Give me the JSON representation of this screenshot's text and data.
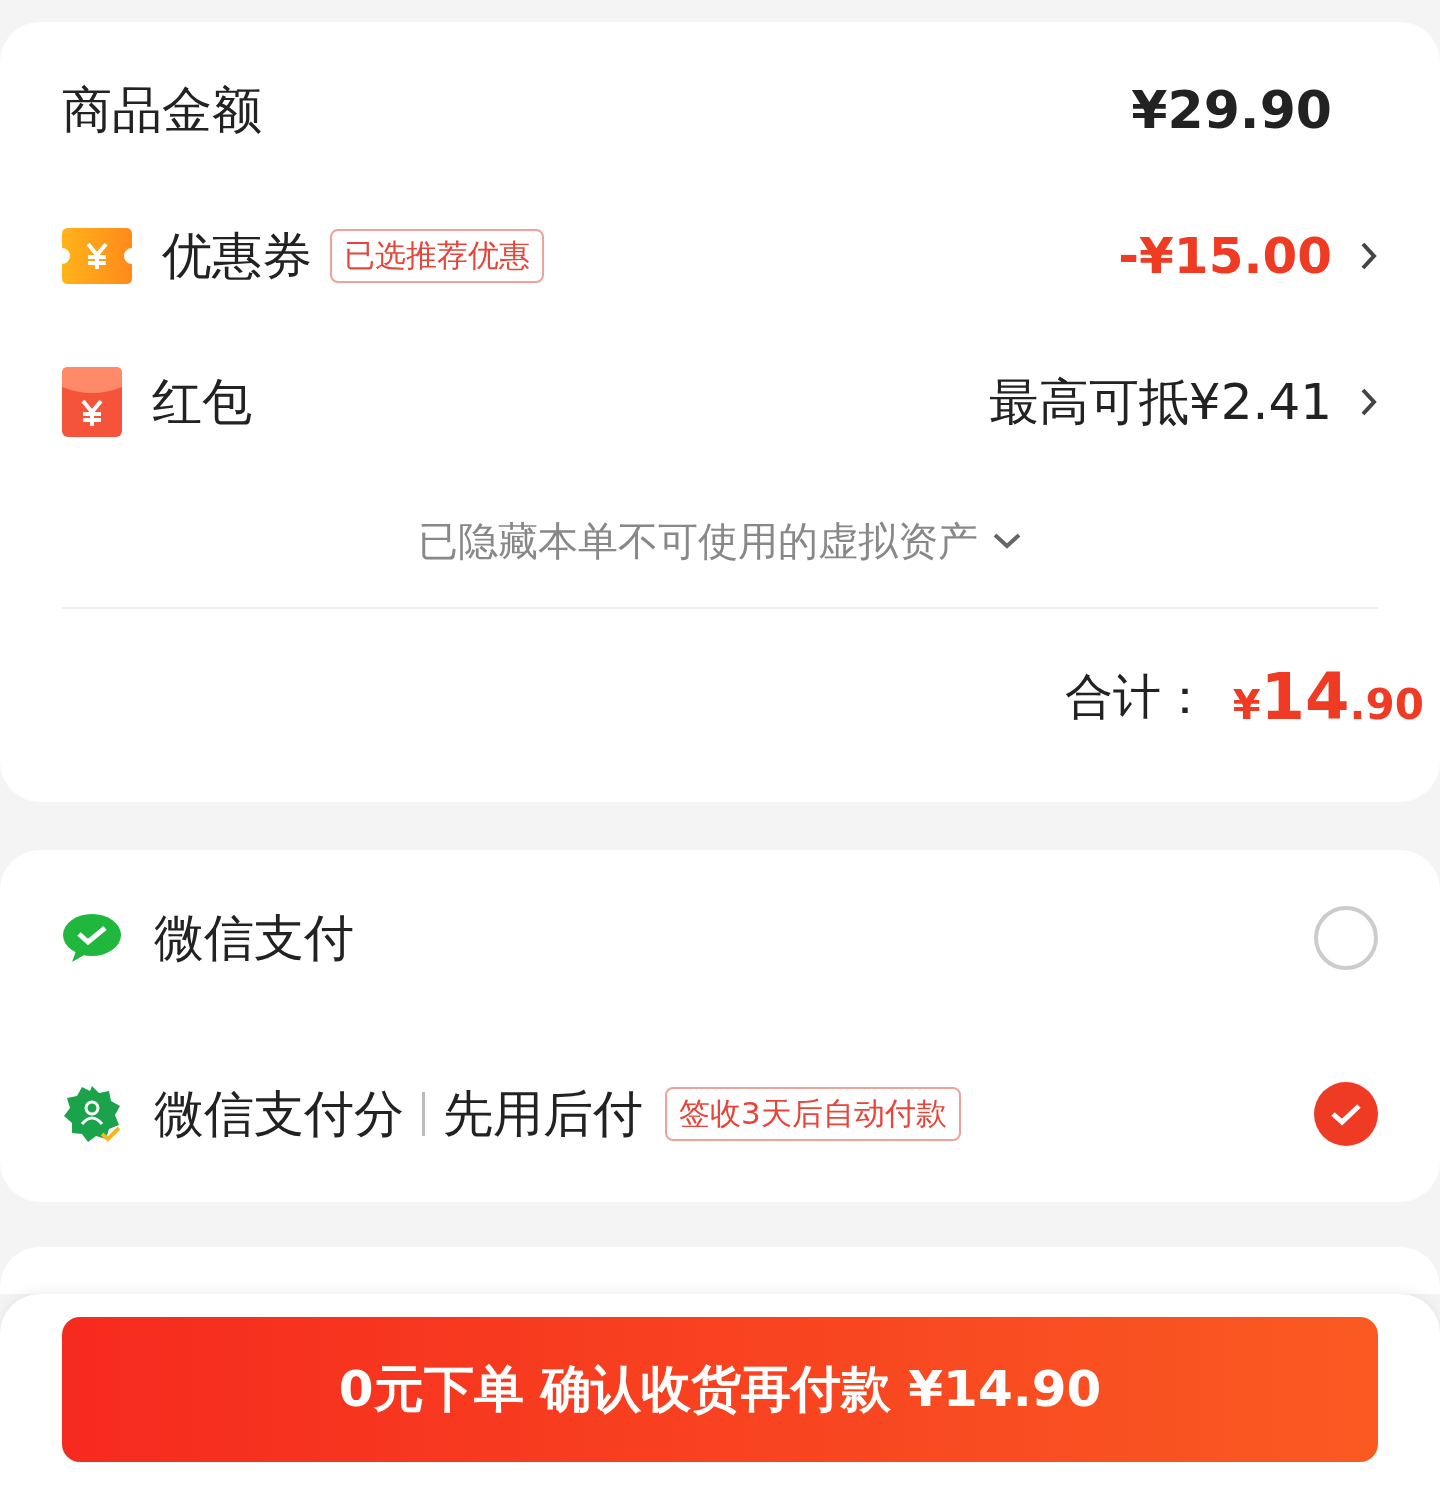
{
  "price_rows": [
    {
      "kind": "plain",
      "label": "商品金额",
      "value": "¥29.90",
      "arrow": false
    },
    {
      "kind": "coupon",
      "label": "优惠券",
      "tag": "已选推荐优惠",
      "value": "-¥15.00",
      "arrow": true
    },
    {
      "kind": "redpacket",
      "label": "红包",
      "value": "最高可抵¥2.41",
      "arrow": true
    }
  ],
  "hidden_assets": "已隐藏本单不可使用的虚拟资产",
  "total": {
    "label": "合计：",
    "currency": "¥",
    "integer": "14",
    "decimal": ".90"
  },
  "payment_methods": [
    {
      "kind": "wechat",
      "label": "微信支付",
      "selected": false
    },
    {
      "kind": "payscore",
      "label": "微信支付分",
      "sub": "先用后付",
      "tag": "签收3天后自动付款",
      "selected": true
    }
  ],
  "submit": "0元下单 确认收货再付款 ¥14.90"
}
